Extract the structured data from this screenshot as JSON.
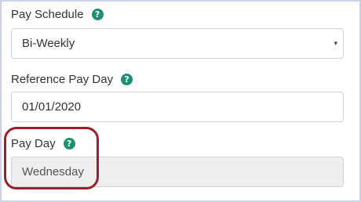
{
  "form": {
    "pay_schedule": {
      "label": "Pay Schedule",
      "help": "?",
      "value": "Bi-Weekly",
      "caret": "▾"
    },
    "reference_pay_day": {
      "label": "Reference Pay Day",
      "help": "?",
      "value": "01/01/2020"
    },
    "pay_day": {
      "label": "Pay Day",
      "help": "?",
      "value": "Wednesday"
    }
  },
  "colors": {
    "help_badge": "#1f8f72",
    "highlight_annotation": "#9b1f28",
    "disabled_field": "#eeeeee",
    "frame_border": "#c9d3e4"
  }
}
